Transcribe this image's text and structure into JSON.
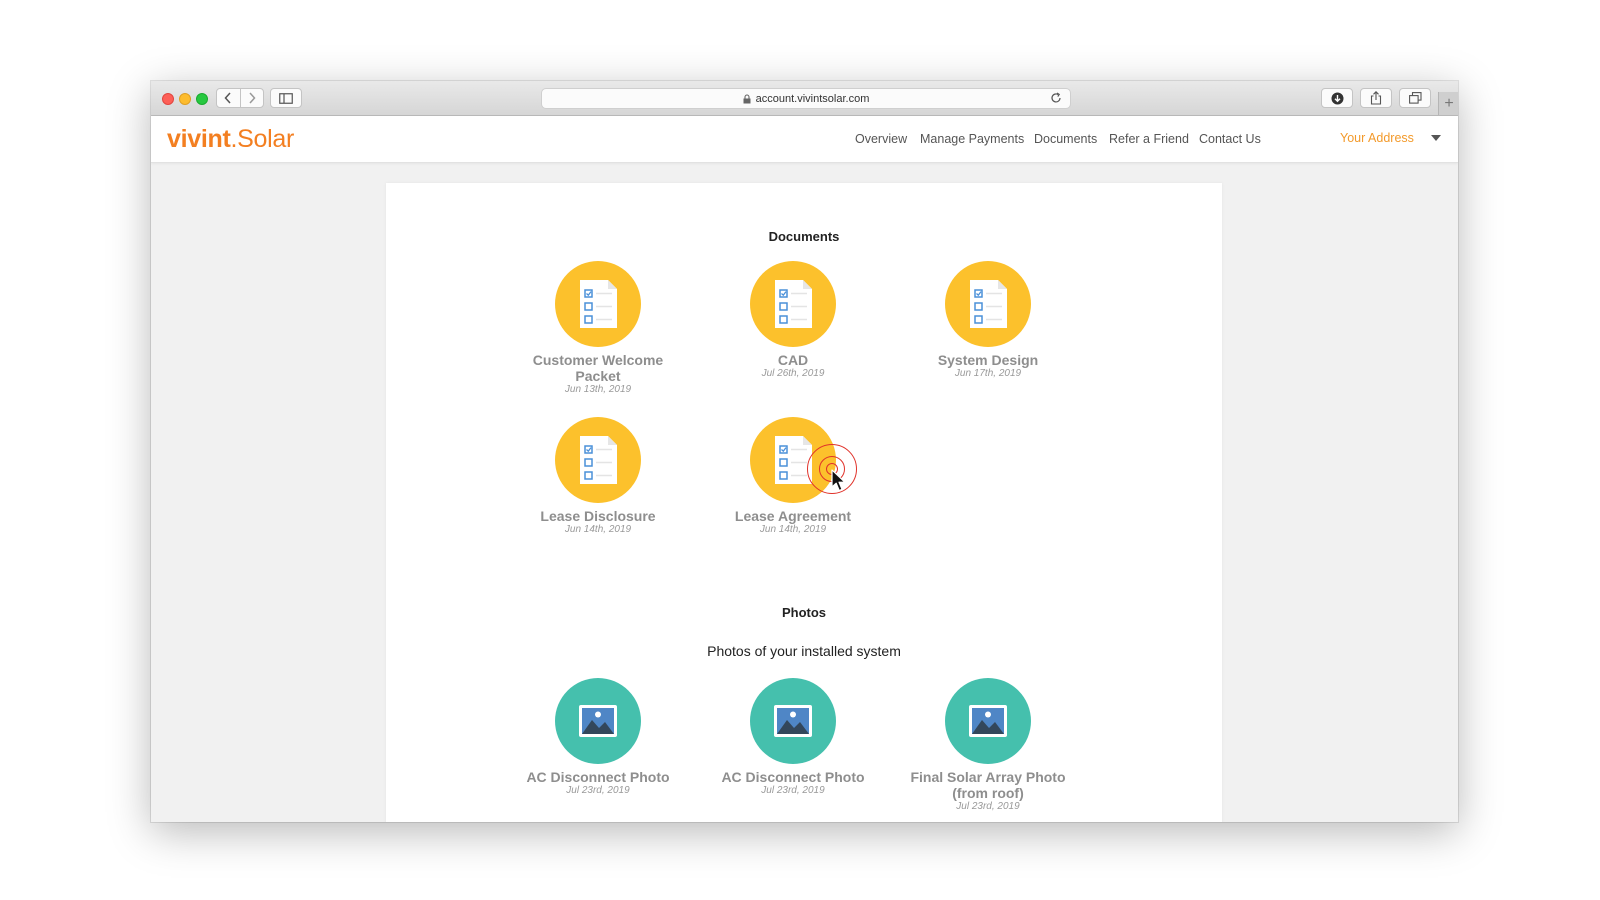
{
  "browser": {
    "url": "account.vivintsolar.com",
    "plus_glyph": "+"
  },
  "header": {
    "logo_bold": "vivint",
    "logo_dot": ".",
    "logo_light": "Solar",
    "nav": [
      "Overview",
      "Manage Payments",
      "Documents",
      "Refer a Friend",
      "Contact Us"
    ],
    "address_label": "Your Address"
  },
  "documents": {
    "title": "Documents",
    "items": [
      {
        "label": "Customer Welcome Packet",
        "date": "Jun 13th, 2019"
      },
      {
        "label": "CAD",
        "date": "Jul 26th, 2019"
      },
      {
        "label": "System Design",
        "date": "Jun 17th, 2019"
      },
      {
        "label": "Lease Disclosure",
        "date": "Jun 14th, 2019"
      },
      {
        "label": "Lease Agreement",
        "date": "Jun 14th, 2019"
      }
    ]
  },
  "photos": {
    "title": "Photos",
    "subtitle": "Photos of your installed system",
    "items": [
      {
        "label": "AC Disconnect Photo",
        "date": "Jul 23rd, 2019"
      },
      {
        "label": "AC Disconnect Photo",
        "date": "Jul 23rd, 2019"
      },
      {
        "label": "Final Solar Array Photo (from roof)",
        "date": "Jul 23rd, 2019"
      }
    ]
  },
  "colors": {
    "brand_orange": "#f37f21",
    "doc_icon_yellow": "#fcc12c",
    "photo_icon_teal": "#45c0ad",
    "click_indicator_red": "#e0322a"
  },
  "icons": {
    "document": "checklist-document-icon",
    "photo": "image-icon"
  }
}
